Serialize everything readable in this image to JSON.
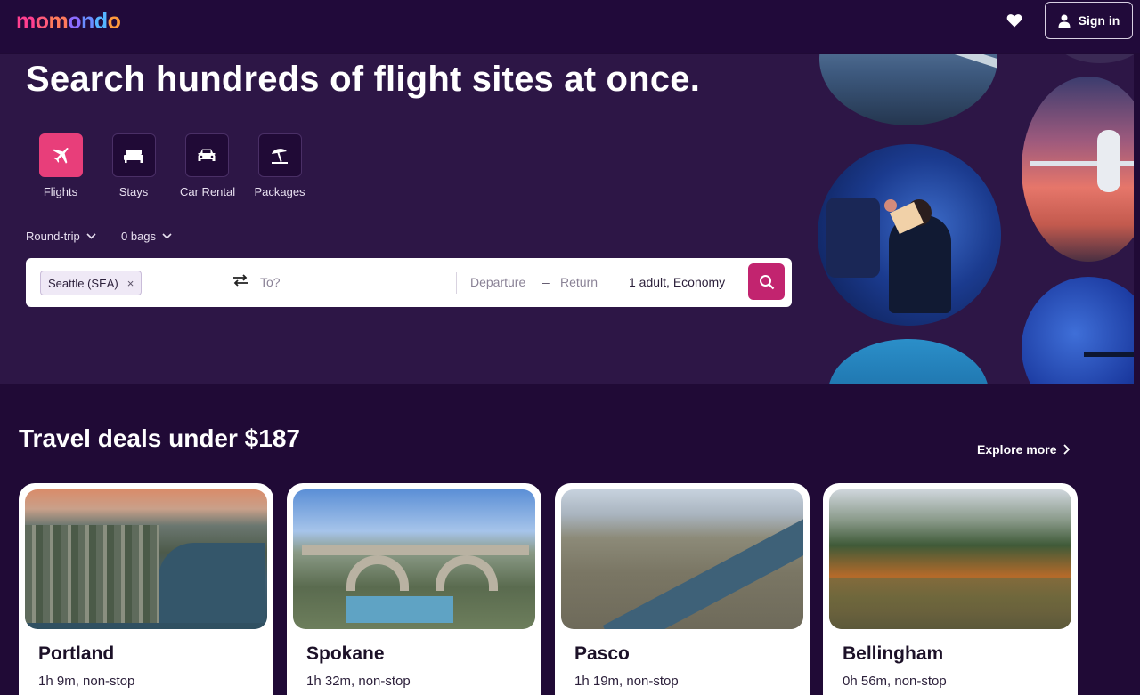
{
  "header": {
    "logo_text": "momondo",
    "signin_label": "Sign in"
  },
  "hero": {
    "title": "Search hundreds of flight sites at once.",
    "verticals": [
      {
        "label": "Flights",
        "icon": "plane-icon",
        "active": true
      },
      {
        "label": "Stays",
        "icon": "bed-icon",
        "active": false
      },
      {
        "label": "Car Rental",
        "icon": "car-icon",
        "active": false
      },
      {
        "label": "Packages",
        "icon": "umbrella-icon",
        "active": false
      }
    ],
    "trip_type": "Round-trip",
    "bags": "0 bags"
  },
  "search": {
    "origin": "Seattle (SEA)",
    "destination_placeholder": "To?",
    "departure_placeholder": "Departure",
    "date_separator": "–",
    "return_placeholder": "Return",
    "travelers": "1 adult, Economy"
  },
  "deals": {
    "title": "Travel deals under $187",
    "explore_label": "Explore more",
    "cards": [
      {
        "city": "Portland",
        "duration": "1h 9m, non-stop"
      },
      {
        "city": "Spokane",
        "duration": "1h 32m, non-stop"
      },
      {
        "city": "Pasco",
        "duration": "1h 19m, non-stop"
      },
      {
        "city": "Bellingham",
        "duration": "0h 56m, non-stop"
      }
    ]
  },
  "colors": {
    "background": "#200a36",
    "hero": "#2d1646",
    "accent": "#e83e7a",
    "search_button": "#c2246f"
  }
}
